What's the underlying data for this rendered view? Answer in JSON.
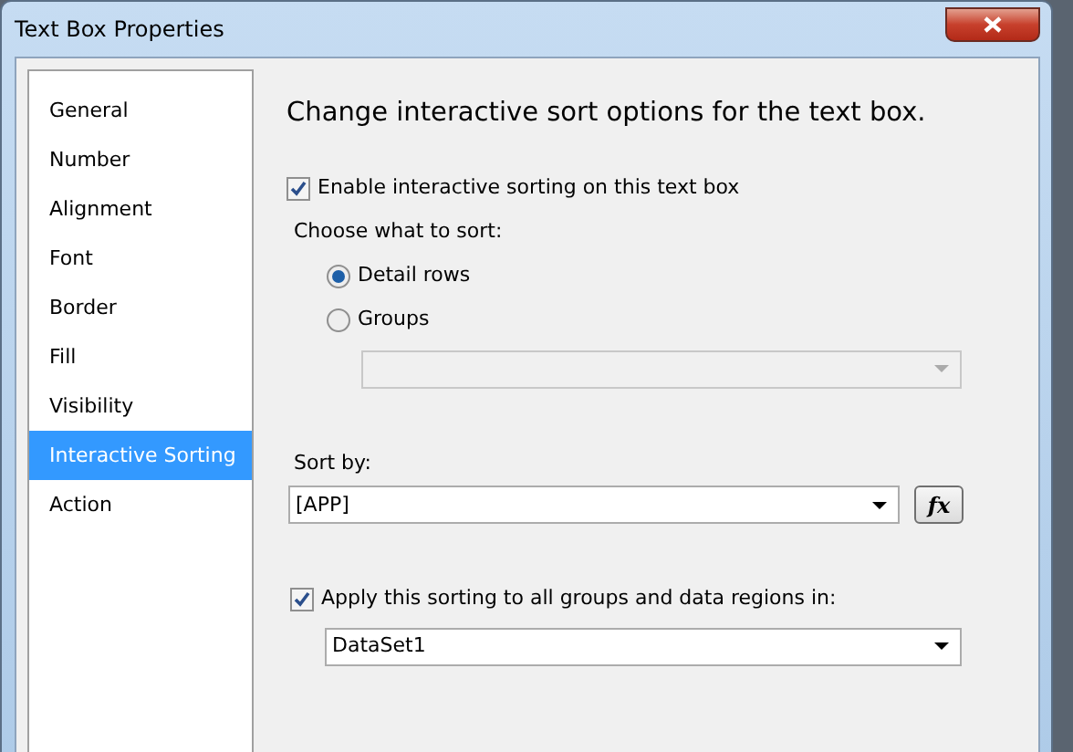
{
  "window": {
    "title": "Text Box Properties"
  },
  "sidebar": {
    "items": [
      {
        "label": "General",
        "selected": false
      },
      {
        "label": "Number",
        "selected": false
      },
      {
        "label": "Alignment",
        "selected": false
      },
      {
        "label": "Font",
        "selected": false
      },
      {
        "label": "Border",
        "selected": false
      },
      {
        "label": "Fill",
        "selected": false
      },
      {
        "label": "Visibility",
        "selected": false
      },
      {
        "label": "Interactive Sorting",
        "selected": true
      },
      {
        "label": "Action",
        "selected": false
      }
    ]
  },
  "heading": "Change interactive sort options for the text box.",
  "enable_sorting": {
    "label": "Enable interactive sorting on this text box",
    "checked": true
  },
  "choose_label": "Choose what to sort:",
  "sort_targets": [
    {
      "label": "Detail rows",
      "selected": true
    },
    {
      "label": "Groups",
      "selected": false
    }
  ],
  "groups_combo": {
    "disabled": true
  },
  "sort_by": {
    "label": "Sort by:",
    "value": "[APP]",
    "fx_button": "fx"
  },
  "apply_all": {
    "label": "Apply this sorting to all groups and data regions in:",
    "checked": true
  },
  "scope_combo": {
    "value": "DataSet1"
  }
}
